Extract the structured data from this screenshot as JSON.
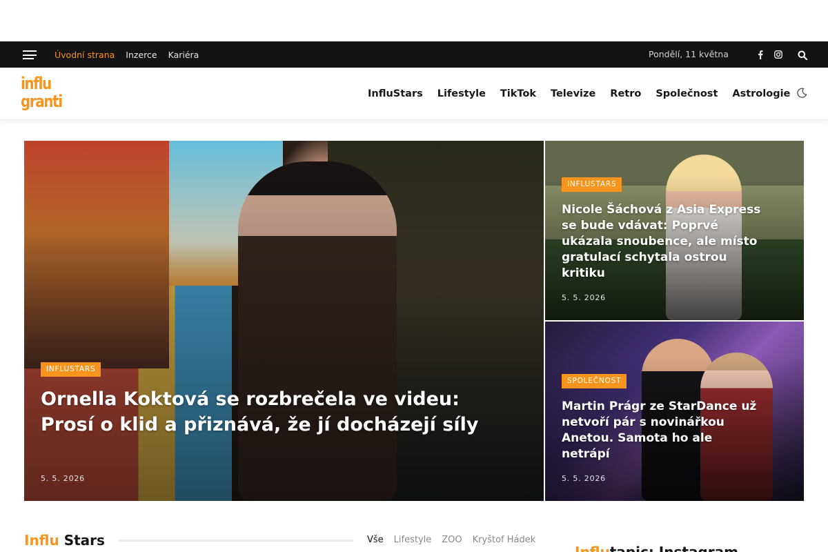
{
  "topbar": {
    "links": [
      {
        "label": "Úvodní strana",
        "active": true
      },
      {
        "label": "Inzerce",
        "active": false
      },
      {
        "label": "Kariéra",
        "active": false
      }
    ],
    "date": "Pondělí, 11 května"
  },
  "header": {
    "logo_line1": "influ",
    "logo_line2": "granti",
    "nav": [
      "InfluStars",
      "Lifestyle",
      "TikTok",
      "Televize",
      "Retro",
      "Společnost",
      "Astrologie"
    ]
  },
  "featured": {
    "main": {
      "category": "INFLUSTARS",
      "title": "Ornella Koktová se rozbrečela ve videu: Prosí o klid a přiznává, že jí docházejí síly",
      "date": "5. 5. 2026"
    },
    "side1": {
      "category": "INFLUSTARS",
      "title": "Nicole Šáchová z Asia Express se bude vdávat: Poprvé ukázala snoubence, ale místo gratulací schytala ostrou kritiku",
      "date": "5. 5. 2026"
    },
    "side2": {
      "category": "SPOLEČNOST",
      "title": "Martin Prágr ze StarDance už netvoří pár s novinářkou Anetou. Samota ho ale netrápí",
      "date": "5. 5. 2026"
    }
  },
  "section": {
    "title_accent": "Influ",
    "title_rest": " Stars",
    "filters": [
      "Vše",
      "Lifestyle",
      "ZOO",
      "Kryštof Hádek"
    ],
    "active_filter": "Vše"
  },
  "sidebar": {
    "title_accent": "Influ",
    "title_rest": "tapic: Instagram"
  },
  "colors": {
    "accent": "#f7941d",
    "topbar_bg": "#131313"
  }
}
